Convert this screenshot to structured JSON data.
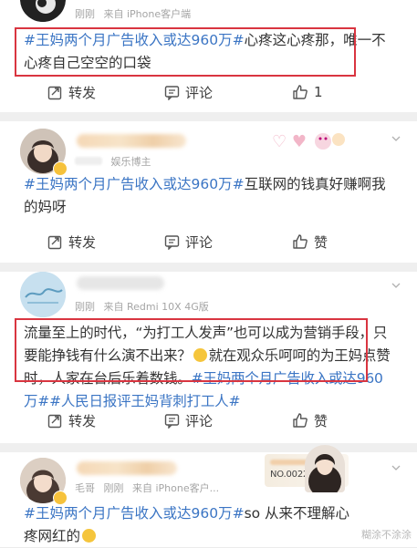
{
  "posts": [
    {
      "time": "刚刚",
      "source": "来自 iPhone客户端",
      "text_tag": "#王妈两个月广告收入或达960万#",
      "text_body": "心疼这心疼那，唯一不心疼自己空空的口袋",
      "repost_label": "转发",
      "comment_label": "评论",
      "like_label": "1"
    },
    {
      "badge": "娱乐博主",
      "text_tag": "#王妈两个月广告收入或达960万#",
      "text_body": "互联网的钱真好赚啊我的妈呀",
      "repost_label": "转发",
      "comment_label": "评论",
      "like_label": "赞"
    },
    {
      "time": "刚刚",
      "source": "来自 Redmi 10X 4G版",
      "text_line1": "流量至上的时代，“为打工人发声”也可以成为营销手段，",
      "text_line2": "只要能挣钱有什么演不出来？",
      "text_line3": "就在观众乐呵呵的为王",
      "text_line4": "妈点赞时，人家在台后乐着数钱。",
      "tag1": "#王妈两个月广告收",
      "tag1b": "入或达960万#",
      "tag2": "#人民日报评王妈背刺打工人#",
      "repost_label": "转发",
      "comment_label": "评论",
      "like_label": "赞"
    },
    {
      "time": "毛哥",
      "time2": "刚刚",
      "source": "来自 iPhone客户...",
      "card_number": "NO.0022103",
      "text_tag": "#王妈两个月广告收入或达960万#",
      "text_body": "so 从来不理解心疼网红的",
      "watermark": "糊涂不涂涂"
    }
  ],
  "icons": {
    "repost": "repost-icon",
    "comment": "comment-icon",
    "like": "like-icon",
    "chevron": "chevron-down-icon"
  },
  "colors": {
    "tag_blue": "#3b75c4",
    "red_box": "#d93540"
  }
}
